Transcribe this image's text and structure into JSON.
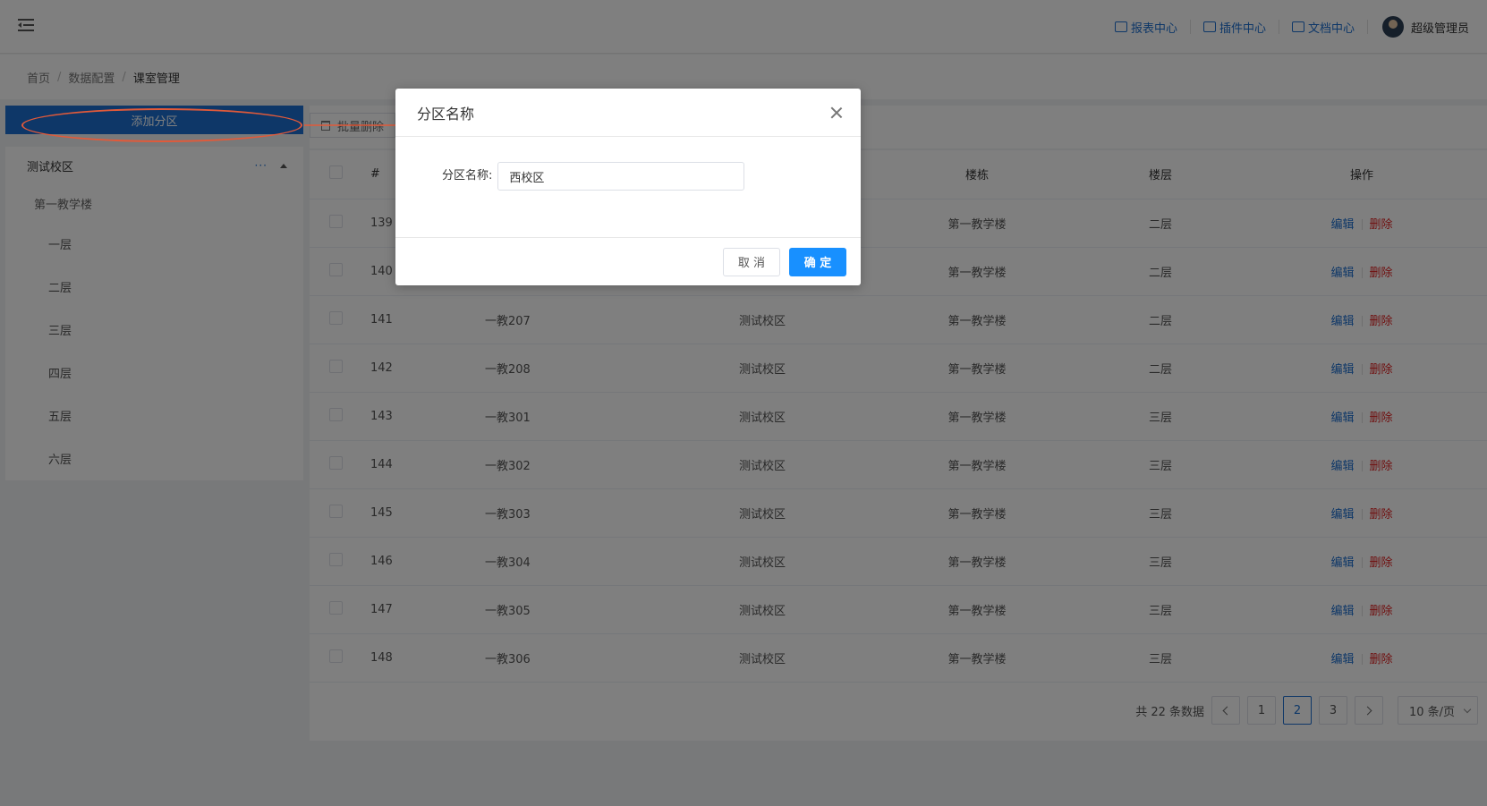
{
  "header": {
    "links": [
      {
        "label": "报表中心",
        "icon": "report-icon"
      },
      {
        "label": "插件中心",
        "icon": "plugin-icon"
      },
      {
        "label": "文档中心",
        "icon": "document-icon"
      }
    ],
    "user_name": "超级管理员"
  },
  "breadcrumb": [
    "首页",
    "数据配置",
    "课室管理"
  ],
  "left_panel": {
    "add_button_label": "添加分区",
    "tree": {
      "campus": "测试校区",
      "more": "···",
      "building": "第一教学楼",
      "floors": [
        "一层",
        "二层",
        "三层",
        "四层",
        "五层",
        "六层"
      ]
    }
  },
  "toolbar": {
    "batch_delete_label": "批量删除"
  },
  "table": {
    "headers": [
      "#",
      "",
      "",
      "楼栋",
      "楼层",
      "操作"
    ],
    "rows": [
      {
        "id": "139",
        "name": "",
        "campus": "",
        "building": "第一教学楼",
        "floor": "二层"
      },
      {
        "id": "140",
        "name": "",
        "campus": "",
        "building": "第一教学楼",
        "floor": "二层"
      },
      {
        "id": "141",
        "name": "一教207",
        "campus": "测试校区",
        "building": "第一教学楼",
        "floor": "二层"
      },
      {
        "id": "142",
        "name": "一教208",
        "campus": "测试校区",
        "building": "第一教学楼",
        "floor": "二层"
      },
      {
        "id": "143",
        "name": "一教301",
        "campus": "测试校区",
        "building": "第一教学楼",
        "floor": "三层"
      },
      {
        "id": "144",
        "name": "一教302",
        "campus": "测试校区",
        "building": "第一教学楼",
        "floor": "三层"
      },
      {
        "id": "145",
        "name": "一教303",
        "campus": "测试校区",
        "building": "第一教学楼",
        "floor": "三层"
      },
      {
        "id": "146",
        "name": "一教304",
        "campus": "测试校区",
        "building": "第一教学楼",
        "floor": "三层"
      },
      {
        "id": "147",
        "name": "一教305",
        "campus": "测试校区",
        "building": "第一教学楼",
        "floor": "三层"
      },
      {
        "id": "148",
        "name": "一教306",
        "campus": "测试校区",
        "building": "第一教学楼",
        "floor": "三层"
      }
    ],
    "edit_label": "编辑",
    "delete_label": "删除"
  },
  "pagination": {
    "total_text": "共 22 条数据",
    "pages": [
      "1",
      "2",
      "3"
    ],
    "current_page": "2",
    "page_size_label": "10 条/页"
  },
  "modal": {
    "title": "分区名称",
    "field_label": "分区名称:",
    "field_value": "西校区",
    "cancel_label": "取 消",
    "ok_label": "确 定"
  },
  "colors": {
    "primary": "#1c6fd0",
    "confirm": "#1890ff",
    "danger": "#e02020",
    "annotation": "#e15a3a"
  }
}
